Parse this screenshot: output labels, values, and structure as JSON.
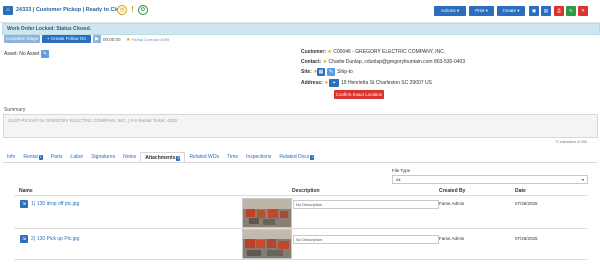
{
  "header": {
    "title": "24333 | Customer Pickup | Ready to Close",
    "clock_icon": "clock-icon",
    "alert_icon": "exclamation-icon",
    "settings_icon": "gear-icon",
    "actions_label": "Actions",
    "print_label": "Print",
    "create_label": "Create"
  },
  "alert": {
    "text": "Work Order Locked: Status Closed."
  },
  "actions": {
    "complete_stage": "Complete Stage",
    "create_follow_on": "+ Create Follow On",
    "timer": "00:00:00",
    "partial": "Partial Contract 4069"
  },
  "asset": {
    "label": "Asset:",
    "value": "No Asset"
  },
  "customer": {
    "label": "Customer:",
    "value": "C00046 - GREGORY ELECTRIC COMPANY, INC.",
    "contact_label": "Contact:",
    "contact_value": "Charlie Dunlap, cdunlap@gregoryfountain.com 803-530-0403",
    "site_label": "Site:",
    "site_value": "Ship-to",
    "address_label": "Address:",
    "address_value": "19 Henrietta St Charleston SC 29007 US",
    "confirm_label": "Confirm Exact Location"
  },
  "summary": {
    "label": "Summary",
    "text": "CUST-PICKUP for GREGORY ELECTRIC COMPANY, INC. | For Rental Ticket: 4339",
    "chars": "72 characters of 255"
  },
  "tabs": [
    {
      "label": "Info",
      "badge": ""
    },
    {
      "label": "Rental",
      "badge": "1"
    },
    {
      "label": "Parts",
      "badge": ""
    },
    {
      "label": "Labor",
      "badge": ""
    },
    {
      "label": "Signatures",
      "badge": ""
    },
    {
      "label": "Notes",
      "badge": ""
    },
    {
      "label": "Attachments",
      "badge": "2"
    },
    {
      "label": "Related WOs",
      "badge": ""
    },
    {
      "label": "Time",
      "badge": ""
    },
    {
      "label": "Inspections",
      "badge": ""
    },
    {
      "label": "Related Docs",
      "badge": "1"
    }
  ],
  "filter": {
    "label": "File Type",
    "value": "All"
  },
  "table": {
    "columns": {
      "name": "Name",
      "description": "Description",
      "created_by": "Created By",
      "date": "Date"
    },
    "rows": [
      {
        "name": "1) 130 drop off pic.jpg",
        "description": "No Description",
        "created_by": "Fame Admin",
        "date": "07/28/2025"
      },
      {
        "name": "2) 130 Pick up Pic.jpg",
        "description": "No Description",
        "created_by": "Fame Admin",
        "date": "07/28/2025"
      }
    ]
  },
  "colors": {
    "primary": "#2a6ebd",
    "success": "#2e9a48",
    "danger": "#d9352e",
    "alert_bg": "#cfe6f0"
  }
}
